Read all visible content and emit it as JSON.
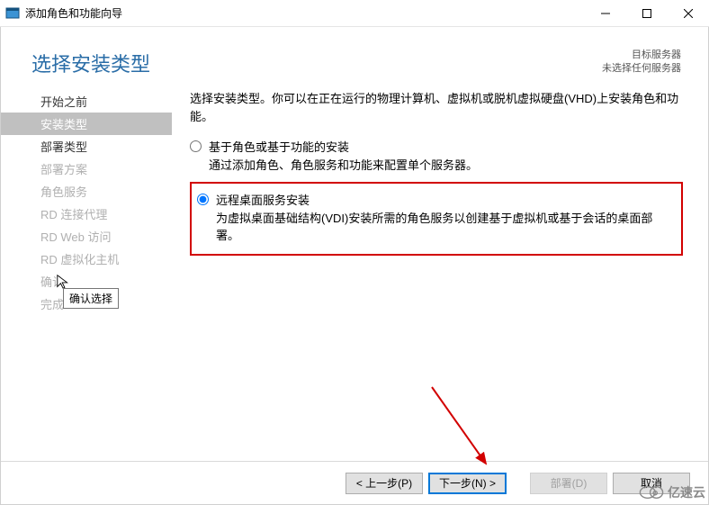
{
  "window": {
    "title": "添加角色和功能向导"
  },
  "header": {
    "title": "选择安装类型",
    "server_label": "目标服务器",
    "server_value": "未选择任何服务器"
  },
  "nav": {
    "items": [
      {
        "label": "开始之前"
      },
      {
        "label": "安装类型"
      },
      {
        "label": "部署类型"
      },
      {
        "label": "部署方案"
      },
      {
        "label": "角色服务"
      },
      {
        "label": "RD 连接代理"
      },
      {
        "label": "RD Web 访问"
      },
      {
        "label": "RD 虚拟化主机"
      },
      {
        "label": "确认"
      },
      {
        "label": "完成"
      }
    ],
    "tooltip": "确认选择"
  },
  "content": {
    "intro": "选择安装类型。你可以在正在运行的物理计算机、虚拟机或脱机虚拟硬盘(VHD)上安装角色和功能。",
    "options": [
      {
        "title": "基于角色或基于功能的安装",
        "desc": "通过添加角色、角色服务和功能来配置单个服务器。"
      },
      {
        "title": "远程桌面服务安装",
        "desc": "为虚拟桌面基础结构(VDI)安装所需的角色服务以创建基于虚拟机或基于会话的桌面部署。"
      }
    ]
  },
  "footer": {
    "prev": "< 上一步(P)",
    "next": "下一步(N) >",
    "deploy": "部署(D)",
    "cancel": "取消"
  },
  "watermark": "亿速云"
}
